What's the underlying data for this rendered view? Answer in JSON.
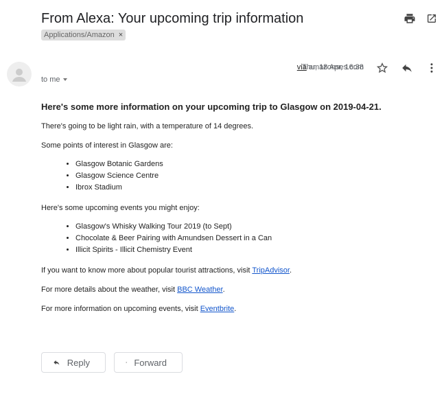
{
  "header": {
    "subject": "From Alexa: Your upcoming trip information",
    "label": "Applications/Amazon",
    "label_close": "×",
    "icons": [
      "print-icon",
      "open-in-new-window-icon"
    ]
  },
  "message": {
    "recipient": "to me",
    "via_text": "via",
    "via_domain": "amazonses.com",
    "date": "Thu, 18 Apr, 16:38",
    "icons": [
      "avatar-icon",
      "star-icon",
      "reply-icon",
      "more-vert-icon"
    ]
  },
  "body": {
    "heading": "Here's some more information on your upcoming trip to Glasgow on 2019-04-21.",
    "weather": "There's going to be light rain, with a temperature of 14 degrees.",
    "poi_intro": "Some points of interest in Glasgow are:",
    "poi": [
      "Glasgow Botanic Gardens",
      "Glasgow Science Centre",
      "Ibrox Stadium"
    ],
    "events_intro": "Here's some upcoming events you might enjoy:",
    "events": [
      "Glasgow's Whisky Walking Tour 2019 (to Sept)",
      "Chocolate & Beer Pairing with Amundsen Dessert in a Can",
      "Illicit Spirits - Illicit Chemistry Event"
    ],
    "attractions_prefix": "If you want to know more about popular tourist attractions, visit ",
    "attractions_link": "TripAdvisor",
    "weather_prefix": "For more details about the weather, visit ",
    "weather_link": "BBC Weather",
    "events_prefix": "For more information on upcoming events, visit ",
    "events_link": "Eventbrite",
    "period": "."
  },
  "actions": {
    "reply": "Reply",
    "forward": "Forward"
  },
  "colors": {
    "link": "#1155cc",
    "label_bg": "#dddddd",
    "icon": "#5f6368"
  }
}
